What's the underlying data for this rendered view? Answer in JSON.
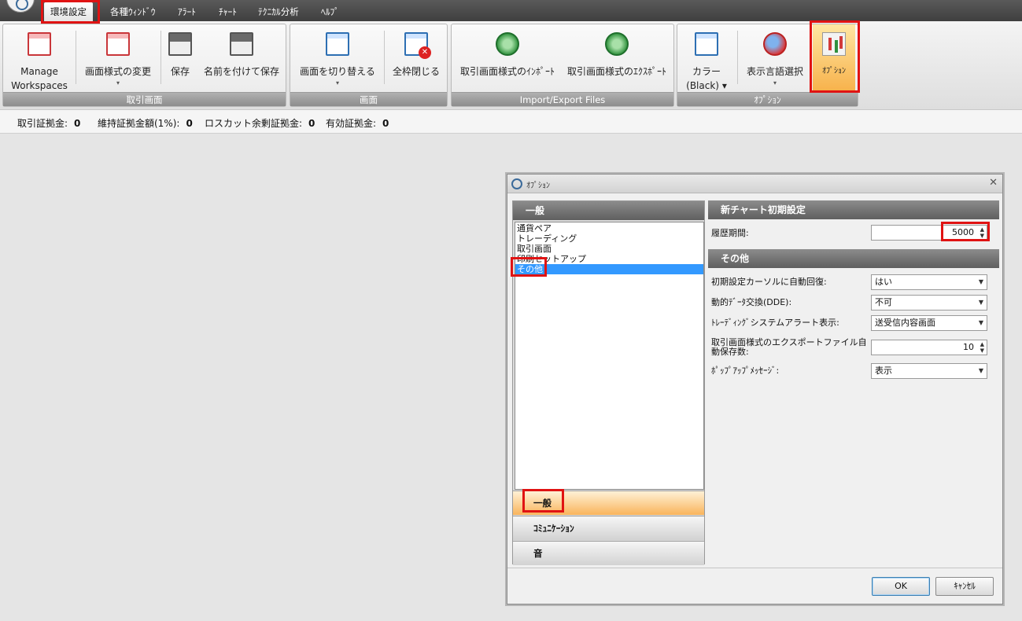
{
  "menu": {
    "items": [
      "環境設定",
      "各種ｳｨﾝﾄﾞｳ",
      "ｱﾗｰﾄ",
      "ﾁｬｰﾄ",
      "ﾃｸﾆｶﾙ分析",
      "ﾍﾙﾌﾟ"
    ]
  },
  "ribbon": {
    "groups": {
      "torihiki": "取引画面",
      "gamen": "画面",
      "import_export": "Import/Export Files",
      "option": "ｵﾌﾟｼｮﾝ"
    },
    "buttons": {
      "manage_1": "Manage",
      "manage_2": "Workspaces",
      "change_layout": "画面様式の変更",
      "save": "保存",
      "save_as": "名前を付けて保存",
      "switch_screen": "画面を切り替える",
      "close_all": "全枠閉じる",
      "import": "取引画面様式のｲﾝﾎﾟｰﾄ",
      "export": "取引画面様式のｴｸｽﾎﾟｰﾄ",
      "color_1": "カラー",
      "color_2": "(Black)",
      "language": "表示言語選択",
      "options": "ｵﾌﾟｼｮﾝ"
    },
    "dropdown_glyph": "▾"
  },
  "account": {
    "trading_margin_label": "取引証拠金:",
    "trading_margin_value": "0",
    "maintenance_margin_label": "維持証拠金額(1%):",
    "maintenance_margin_value": "0",
    "losscut_label": "ロスカット余剰証拠金:",
    "losscut_value": "0",
    "effective_margin_label": "有効証拠金:",
    "effective_margin_value": "0"
  },
  "dialog": {
    "title": "ｵﾌﾟｼｮﾝ",
    "close_glyph": "✕",
    "left_header": "一般",
    "list_items": [
      "通貨ペア",
      "トレーディング",
      "取引画面",
      "印刷セットアップ",
      "その他"
    ],
    "nav_buttons": [
      "一般",
      "ｺﾐｭﾆｹｰｼｮﾝ",
      "音"
    ],
    "section_new_chart": "新チャート初期設定",
    "history_label": "履歴期間:",
    "history_value": "5000",
    "section_other": "その他",
    "rows": [
      {
        "label": "初期設定カーソルに自動回復:",
        "value": "はい"
      },
      {
        "label": "動的ﾃﾞｰﾀ交換(DDE):",
        "value": "不可"
      },
      {
        "label": "ﾄﾚｰﾃﾞｨﾝｸﾞシステムアラート表示:",
        "value": "送受信内容画面"
      },
      {
        "label": "取引画面様式のエクスポートファイル自動保存数:",
        "value": "10"
      },
      {
        "label": "ﾎﾟｯﾌﾟｱｯﾌﾟﾒｯｾｰｼﾞ:",
        "value": "表示"
      }
    ],
    "ok_label": "OK",
    "cancel_label": "ｷｬﾝｾﾙ",
    "dropdown_glyph": "▼",
    "spin_glyph": "▲▼"
  }
}
